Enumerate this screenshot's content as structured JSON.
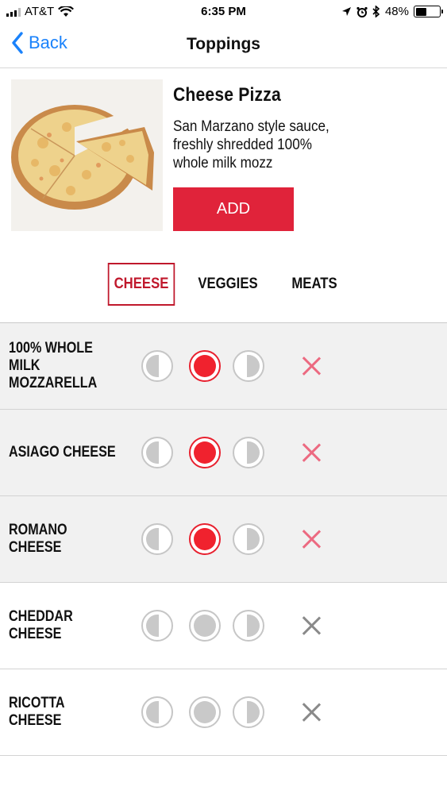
{
  "status_bar": {
    "carrier": "AT&T",
    "time": "6:35 PM",
    "battery": "48%",
    "battery_level": 0.48,
    "icons": [
      "signal-icon",
      "wifi-icon",
      "location-icon",
      "alarm-icon",
      "bluetooth-icon",
      "battery-icon"
    ]
  },
  "nav": {
    "back_label": "Back",
    "title": "Toppings"
  },
  "product": {
    "name": "Cheese Pizza",
    "description": "San Marzano style sauce, freshly shredded 100% whole milk mozz",
    "add_label": "ADD"
  },
  "tabs": [
    {
      "label": "CHEESE",
      "active": true
    },
    {
      "label": "VEGGIES",
      "active": false
    },
    {
      "label": "MEATS",
      "active": false
    }
  ],
  "toppings": [
    {
      "name": "100% WHOLE MILK MOZZARELLA",
      "coverage": "whole",
      "selected": true
    },
    {
      "name": "ASIAGO CHEESE",
      "coverage": "whole",
      "selected": true
    },
    {
      "name": "ROMANO CHEESE",
      "coverage": "whole",
      "selected": true
    },
    {
      "name": "CHEDDAR CHEESE",
      "coverage": "none",
      "selected": false
    },
    {
      "name": "RICOTTA CHEESE",
      "coverage": "none",
      "selected": false
    }
  ],
  "colors": {
    "accent": "#e0233a",
    "link": "#1a82fb",
    "selected_row_bg": "#f1f1f1"
  }
}
